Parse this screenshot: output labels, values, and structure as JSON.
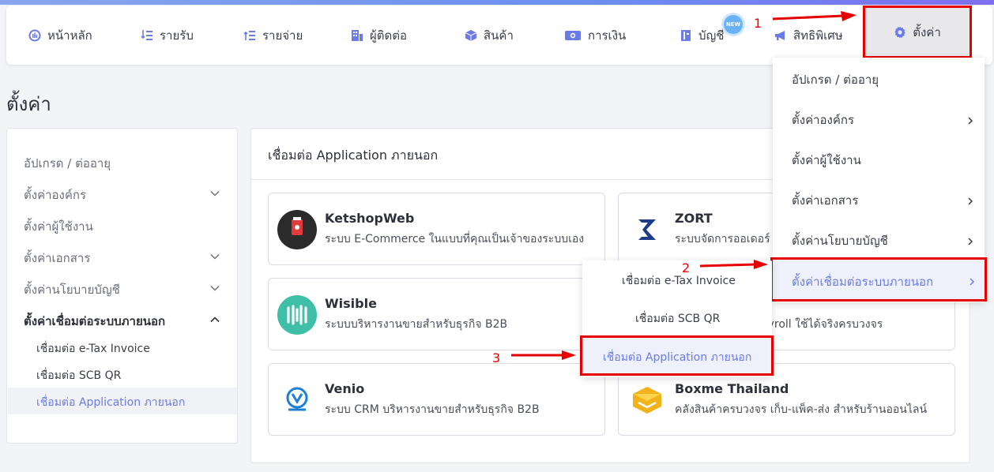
{
  "nav": {
    "items": [
      {
        "label": "หน้าหลัก",
        "icon": "dashboard-icon"
      },
      {
        "label": "รายรับ",
        "icon": "income-icon"
      },
      {
        "label": "รายจ่าย",
        "icon": "expense-icon"
      },
      {
        "label": "ผู้ติดต่อ",
        "icon": "contacts-icon"
      },
      {
        "label": "สินค้า",
        "icon": "box-icon"
      },
      {
        "label": "การเงิน",
        "icon": "money-icon"
      },
      {
        "label": "บัญชี",
        "icon": "ledger-icon"
      },
      {
        "label": "สิทธิพิเศษ",
        "icon": "megaphone-icon"
      }
    ],
    "new_badge": "NEW",
    "settings_label": "ตั้งค่า"
  },
  "page": {
    "title": "ตั้งค่า"
  },
  "sidebar": {
    "items": [
      {
        "label": "อัปเกรด / ต่ออายุ"
      },
      {
        "label": "ตั้งค่าองค์กร"
      },
      {
        "label": "ตั้งค่าผู้ใช้งาน"
      },
      {
        "label": "ตั้งค่าเอกสาร"
      },
      {
        "label": "ตั้งค่านโยบายบัญชี"
      },
      {
        "label": "ตั้งค่าเชื่อมต่อระบบภายนอก"
      }
    ],
    "sub_items": [
      {
        "label": "เชื่อมต่อ e-Tax Invoice"
      },
      {
        "label": "เชื่อมต่อ SCB QR"
      },
      {
        "label": "เชื่อมต่อ Application ภายนอก"
      }
    ]
  },
  "main": {
    "title": "เชื่อมต่อ Application ภายนอก",
    "apps": [
      {
        "name": "KetshopWeb",
        "desc": "ระบบ E-Commerce ในแบบที่คุณเป็นเจ้าของระบบเอง",
        "logo_color": "#2b2b2b"
      },
      {
        "name": "ZORT",
        "desc": "ระบบจัดการออเดอร์",
        "logo_color": "#1f3c88"
      },
      {
        "name": "Wisible",
        "desc": "ระบบบริหารงานขายสำหรับธุรกิจ B2B",
        "logo_color": "#3fbfa8"
      },
      {
        "name": "",
        "desc": "ayroll ใช้ได้จริงครบวงจร",
        "logo_color": "#ffffff"
      },
      {
        "name": "Venio",
        "desc": "ระบบ CRM บริหารงานขายสำหรับธุรกิจ B2B",
        "logo_color": "#1b7fd6"
      },
      {
        "name": "Boxme Thailand",
        "desc": "คลังสินค้าครบวงจร เก็บ-แพ็ค-ส่ง สำหรับร้านออนไลน์",
        "logo_color": "#f2b21b"
      }
    ],
    "ketshop_logo_text": "KETSHOP"
  },
  "dropdown": {
    "items": [
      {
        "label": "อัปเกรด / ต่ออายุ"
      },
      {
        "label": "ตั้งค่าองค์กร"
      },
      {
        "label": "ตั้งค่าผู้ใช้งาน"
      },
      {
        "label": "ตั้งค่าเอกสาร"
      },
      {
        "label": "ตั้งค่านโยบายบัญชี"
      }
    ],
    "highlighted": "ตั้งค่าเชื่อมต่อระบบภายนอก"
  },
  "submenu": {
    "items": [
      {
        "label": "เชื่อมต่อ e-Tax Invoice"
      },
      {
        "label": "เชื่อมต่อ SCB QR"
      }
    ],
    "highlighted": "เชื่อมต่อ Application ภายนอก"
  },
  "steps": [
    "1",
    "2",
    "3"
  ],
  "colors": {
    "accent": "#6a7be8",
    "annotation": "#e60000"
  }
}
